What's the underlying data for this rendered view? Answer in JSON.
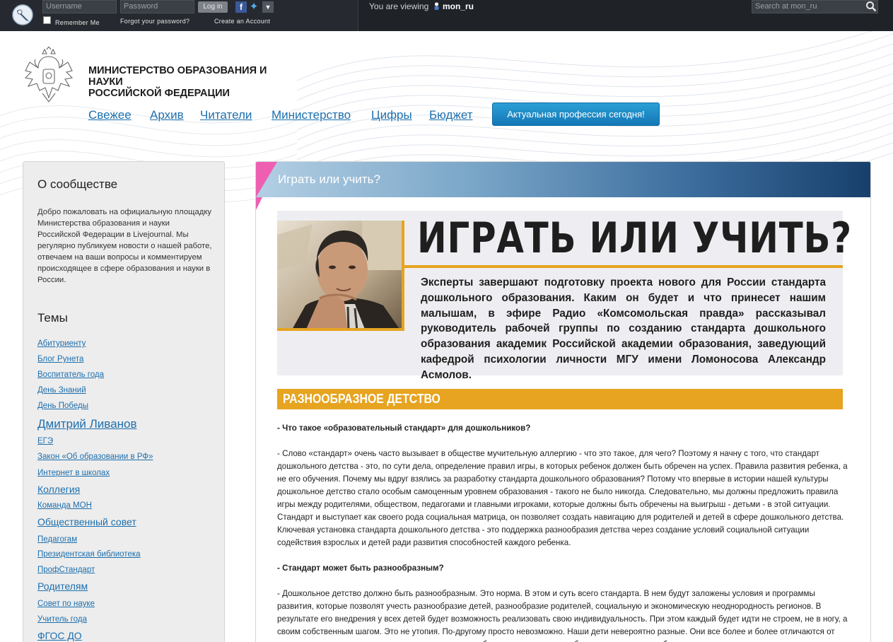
{
  "topbar": {
    "username_placeholder": "Username",
    "password_placeholder": "Password",
    "login_label": "Log in",
    "remember_label": "Remember Me",
    "forgot_label": "Forgot your password?",
    "create_label": "Create an Account",
    "viewing_label": "You are viewing",
    "viewing_user": "mon_ru",
    "search_placeholder": "Search at mon_ru"
  },
  "header": {
    "ministry_line1": "МИНИСТЕРСТВО ОБРАЗОВАНИЯ И НАУКИ",
    "ministry_line2": "РОССИЙСКОЙ ФЕДЕРАЦИИ",
    "nav": [
      "Свежее",
      "Архив",
      "Читатели",
      "Министерство",
      "Цифры",
      "Бюджет"
    ],
    "promo_button": "Актуальная профессия сегодня!"
  },
  "sidebar": {
    "about_title": "О сообществе",
    "about_text": "Добро пожаловать на официальную площадку Министерства образования и науки Российской Федерации в Livejournal. Мы регулярно публикуем новости о нашей работе, отвечаем на ваши вопросы и комментируем происходящее в сфере образования и науки в России.",
    "topics_title": "Темы",
    "topics": [
      {
        "label": "Абитуриенту",
        "size": "small"
      },
      {
        "label": "Блог Рунета",
        "size": "small"
      },
      {
        "label": "Воспитатель года",
        "size": "small"
      },
      {
        "label": "День Знаний",
        "size": "small"
      },
      {
        "label": "День Победы",
        "size": "small"
      },
      {
        "label": "Дмитрий Ливанов",
        "size": "large"
      },
      {
        "label": "ЕГЭ",
        "size": "small"
      },
      {
        "label": "Закон «Об образовании в РФ»",
        "size": "small"
      },
      {
        "label": "Интернет в школах",
        "size": "small"
      },
      {
        "label": "Коллегия",
        "size": "medium"
      },
      {
        "label": "Команда МОН",
        "size": "small"
      },
      {
        "label": "Общественный совет",
        "size": "medium"
      },
      {
        "label": "Педагогам",
        "size": "small"
      },
      {
        "label": "Президентская библиотека",
        "size": "small"
      },
      {
        "label": "ПрофСтандарт",
        "size": "small"
      },
      {
        "label": "Родителям",
        "size": "medium"
      },
      {
        "label": "Совет по науке",
        "size": "small"
      },
      {
        "label": "Учитель года",
        "size": "small"
      },
      {
        "label": "ФГОС ДО",
        "size": "medium"
      }
    ]
  },
  "article": {
    "panel_title": "Играть или учить?",
    "banner_title": "ИГРАТЬ ИЛИ УЧИТЬ?",
    "lead": "Эксперты завершают подготовку проекта нового для России стандарта дошкольного образования. Каким он будет и что принесет нашим малышам, в эфире Радио «Комсомольская правда» рассказывал руководитель рабочей группы по созданию стандарта дошкольного образования академик Российской академии образования, заведующий кафедрой психологии личности МГУ имени Ломоносова Александр Асмолов.",
    "section_title": "РАЗНООБРАЗНОЕ ДЕТСТВО",
    "paragraphs": [
      {
        "type": "q",
        "text": "- Что такое «образовательный стандарт» для дошкольников?"
      },
      {
        "type": "a",
        "text": "- Слово «стандарт» очень часто вызывает в обществе мучительную аллергию - что это такое, для чего? Поэтому я начну с того, что стандарт дошкольного детства - это, по сути дела, определение правил игры, в которых ребенок должен быть обречен на успех. Правила развития ребенка, а не его обучения. Почему мы вдруг взялись за разработку стандарта дошкольного образования? Потому что впервые в истории нашей культуры дошкольное детство стало особым самоценным уровнем образования - такого не было никогда. Следовательно, мы должны предложить правила игры между родителями, обществом, педагогами и главными игроками, которые должны быть обречены на выигрыш - детьми - в этой ситуации. Стандарт и выступает как своего рода социальная матрица, он позволяет создать навигацию для родителей и детей в сфере дошкольного детства. Ключевая установка стандарта дошкольного детства - это поддержка разнообразия детства через создание условий социальной ситуации содействия взрослых и детей ради развития способностей каждого ребенка."
      },
      {
        "type": "q",
        "text": "- Стандарт может быть разнообразным?"
      },
      {
        "type": "a",
        "text": "- Дошкольное детство должно быть разнообразным. Это норма. В этом и суть всего стандарта. В нем будут заложены условия и программы развития, которые позволят учесть разнообразие детей, разнообразие родителей, социальную и экономическую неоднородность регионов. В результате его внедрения у всех детей будет возможность реализовать свою индивидуальность. При этом каждый будет идти не строем, не в ногу, а своим собственным шагом. Это не утопия. По-другому просто невозможно. Наши дети невероятно разные. Они все более и более отличаются от нас, и становится все труднее вести диалог между ребенком и родителем, ребенком и педагогом, ребенком и"
      }
    ]
  },
  "colors": {
    "topbar_bg": "#262a30",
    "link_blue": "#1d6fae",
    "accent_orange": "#e6a420",
    "accent_pink": "#ef5fb1",
    "header_blue_dark": "#173f6c"
  }
}
